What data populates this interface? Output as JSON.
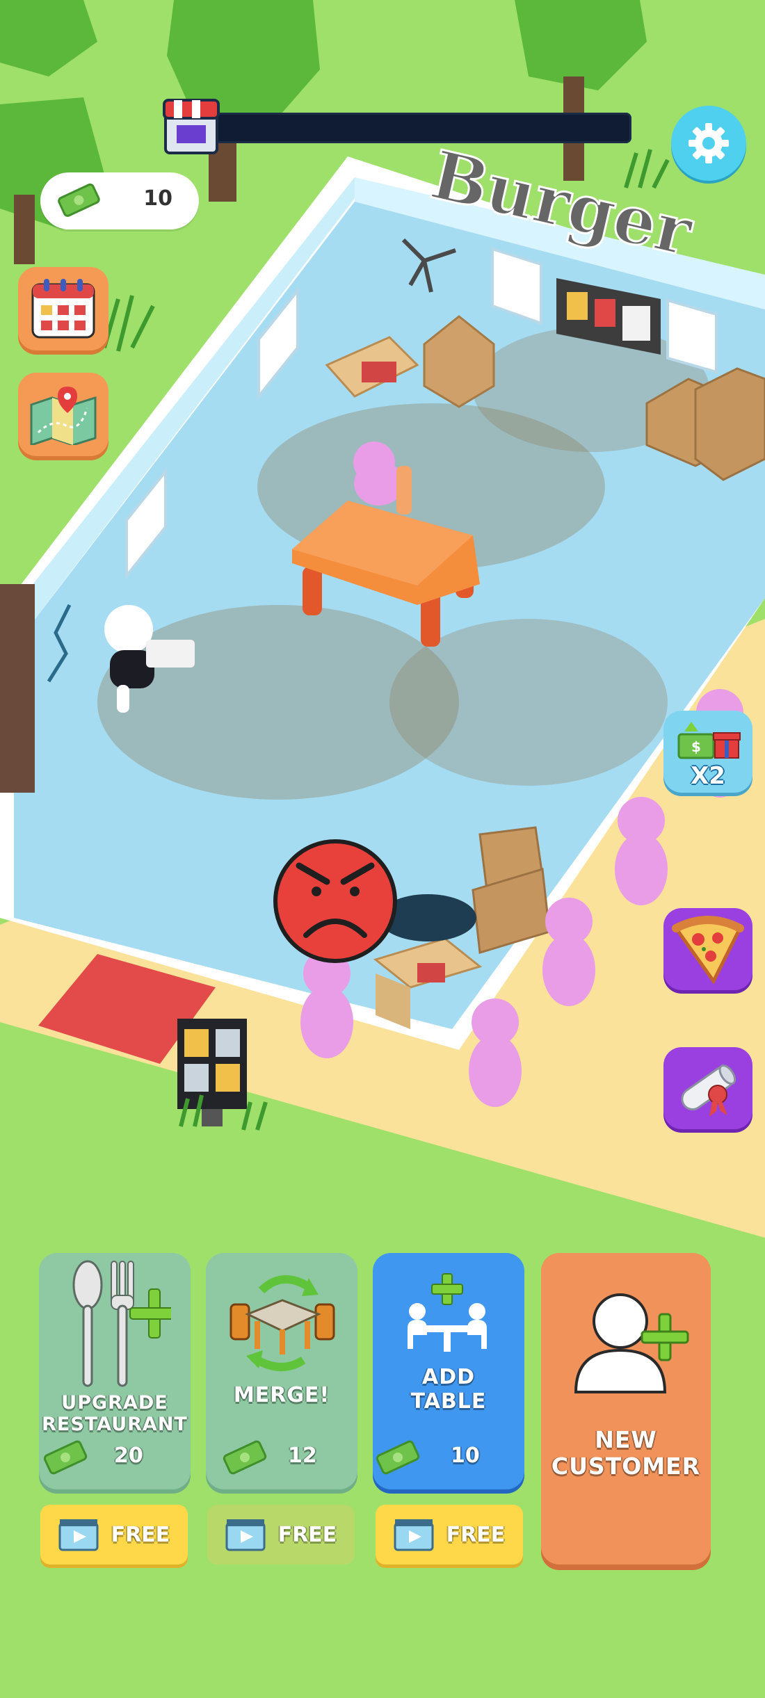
{
  "restaurant": {
    "sign": "Burger"
  },
  "hud": {
    "money": "10",
    "progress_percent": 0,
    "icons": {
      "settings": "gear-icon",
      "store": "store-icon",
      "calendar": "calendar-icon",
      "map": "map-icon"
    }
  },
  "side_buttons": {
    "boost_label": "X2",
    "boost_icon": "gift-cash-icon",
    "pizza_icon": "pizza-icon",
    "diploma_icon": "diploma-icon"
  },
  "actions": {
    "upgrade": {
      "label_line1": "UPGRADE",
      "label_line2": "RESTAURANT",
      "cost": "20",
      "icon": "fork-spoon-plus-icon"
    },
    "merge": {
      "label": "MERGE!",
      "cost": "12",
      "icon": "merge-tables-icon"
    },
    "add_table": {
      "label_line1": "ADD",
      "label_line2": "TABLE",
      "cost": "10",
      "icon": "table-people-plus-icon"
    },
    "new_customer": {
      "label_line1": "NEW",
      "label_line2": "CUSTOMER",
      "icon": "person-plus-icon"
    }
  },
  "free_buttons": [
    {
      "label": "FREE",
      "icon": "video-ad-icon"
    },
    {
      "label": "FREE",
      "icon": "video-ad-icon"
    },
    {
      "label": "FREE",
      "icon": "video-ad-icon"
    }
  ],
  "colors": {
    "grass": "#9ee06a",
    "floor": "#a6dcf2",
    "card_disabled": "#8ec9a3",
    "card_active": "#3f97f0",
    "card_customer": "#f0925a",
    "free_enabled": "#ffd84a",
    "free_disabled": "#b9d86a",
    "customer": "#e89de6",
    "angry_face": "#e8413c",
    "accent_plus": "#7ed13a"
  }
}
